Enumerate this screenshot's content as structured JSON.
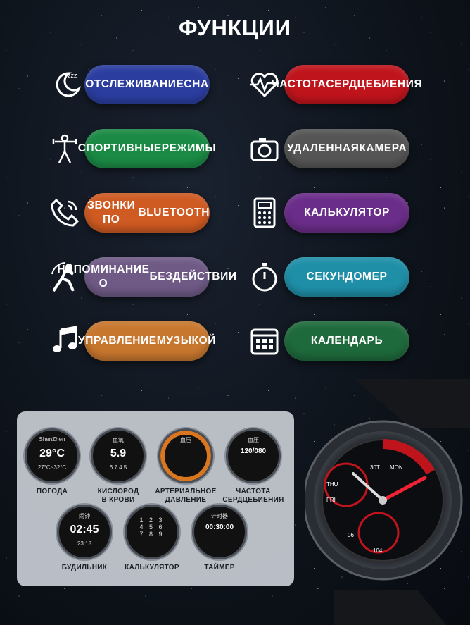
{
  "title": "ФУНКЦИИ",
  "features": [
    {
      "line1": "ОТСЛЕЖИВАНИЕ",
      "line2": "СНА",
      "icon": "sleep-moon-icon",
      "color": "#2b3ea0"
    },
    {
      "line1": "ЧАСТОТА",
      "line2": "СЕРДЦЕБИЕНИЯ",
      "icon": "heart-rate-icon",
      "color": "#c0141c"
    },
    {
      "line1": "СПОРТИВНЫЕ",
      "line2": "РЕЖИМЫ",
      "icon": "fitness-icon",
      "color": "#1b8a45"
    },
    {
      "line1": "УДАЛЕННАЯ",
      "line2": "КАМЕРА",
      "icon": "camera-icon",
      "color": "#555555"
    },
    {
      "line1": "ЗВОНКИ ПО",
      "line2": "BLUETOOTH",
      "icon": "phone-call-icon",
      "color": "#cf5a22"
    },
    {
      "line1": "КАЛЬКУЛЯТОР",
      "line2": "",
      "icon": "calculator-icon",
      "color": "#6b2d8a"
    },
    {
      "line1": "НАПОМИНАНИЕ О",
      "line2": "БЕЗДЕЙСТВИИ",
      "icon": "stretch-person-icon",
      "color": "#6f5a86"
    },
    {
      "line1": "СЕКУНДОМЕР",
      "line2": "",
      "icon": "stopwatch-icon",
      "color": "#1f8fa8"
    },
    {
      "line1": "УПРАВЛЕНИЕ",
      "line2": "МУЗЫКОЙ",
      "icon": "music-note-icon",
      "color": "#c8772e"
    },
    {
      "line1": "КАЛЕНДАРЬ",
      "line2": "",
      "icon": "calendar-icon",
      "color": "#1e6a3c"
    }
  ],
  "watchfaces": [
    {
      "label1": "ПОГОДА",
      "label2": "",
      "top": "ShenZhen",
      "big": "29",
      "unit": "°C",
      "sub": "27°C~32°C"
    },
    {
      "label1": "КИСЛОРОД",
      "label2": "В КРОВИ",
      "top": "血氧",
      "big": "5.9",
      "unit": "",
      "sub": "6.7   4.5"
    },
    {
      "label1": "АРТЕРИАЛЬНОЕ",
      "label2": "ДАВЛЕНИЕ",
      "top": "血压",
      "big": "",
      "unit": "",
      "sub": ""
    },
    {
      "label1": "ЧАСТОТА",
      "label2": "СЕРДЦЕБИЕНИЯ",
      "top": "血压",
      "big": "120/080",
      "unit": "",
      "sub": ""
    },
    {
      "label1": "БУДИЛЬНИК",
      "label2": "",
      "top": "闹钟",
      "big": "02:45",
      "unit": "",
      "sub": "23:18"
    },
    {
      "label1": "КАЛЬКУЛЯТОР",
      "label2": "",
      "top": "",
      "big": "",
      "unit": "",
      "sub": ""
    },
    {
      "label1": "ТАЙМЕР",
      "label2": "",
      "top": "计时器",
      "big": "00:30:00",
      "unit": "",
      "sub": ""
    }
  ],
  "watch": {
    "dial_numbers": [
      "30T",
      "MON",
      "THU",
      "FRI"
    ],
    "small_numbers": [
      "06",
      "104"
    ]
  }
}
